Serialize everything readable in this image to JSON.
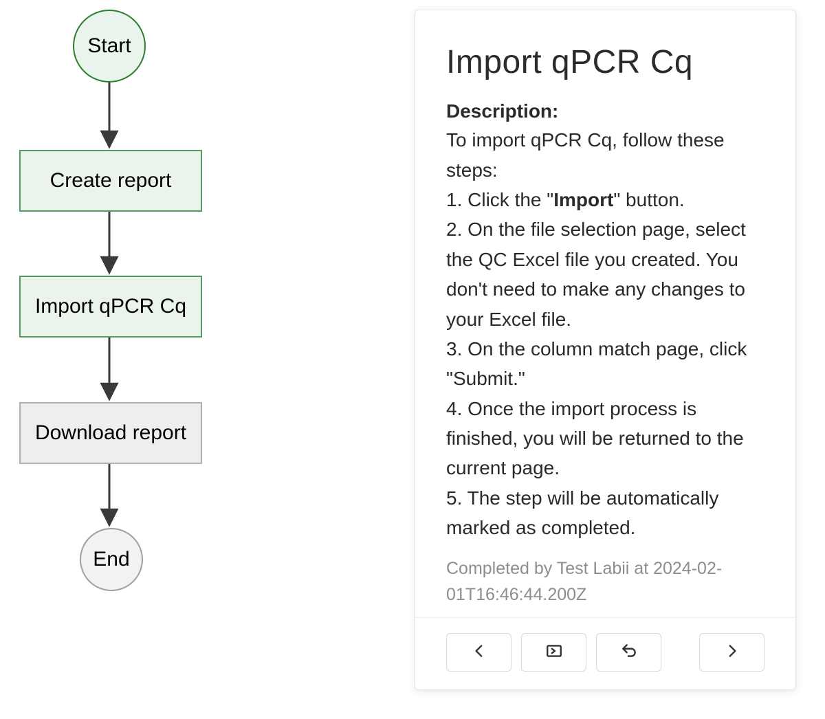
{
  "flowchart": {
    "nodes": {
      "start": {
        "label": "Start",
        "type": "terminator",
        "state": "completed"
      },
      "step1": {
        "label": "Create report",
        "type": "process",
        "state": "completed"
      },
      "step2": {
        "label": "Import qPCR Cq",
        "type": "process",
        "state": "current"
      },
      "step3": {
        "label": "Download report",
        "type": "process",
        "state": "pending"
      },
      "end": {
        "label": "End",
        "type": "terminator",
        "state": "pending"
      }
    },
    "edges": [
      [
        "start",
        "step1"
      ],
      [
        "step1",
        "step2"
      ],
      [
        "step2",
        "step3"
      ],
      [
        "step3",
        "end"
      ]
    ]
  },
  "panel": {
    "title": "Import qPCR Cq",
    "description_label": "Description:",
    "intro": "To import qPCR Cq, follow these steps:",
    "step1_prefix": "1. Click the \"",
    "step1_bold": "Import",
    "step1_suffix": "\" button.",
    "step2": "2. On the file selection page, select the QC Excel file you created. You don't need to make any changes to your Excel file.",
    "step3": "3. On the column match page, click \"Submit.\"",
    "step4": "4. Once the import process is finished, you will be returned to the current page.",
    "step5": "5. The step will be automatically marked as completed.",
    "completed_by": "Completed by Test Labii at 2024-02-01T16:46:44.200Z"
  },
  "footer": {
    "prev": "Previous step",
    "import": "Import",
    "undo": "Undo",
    "next": "Next step"
  }
}
